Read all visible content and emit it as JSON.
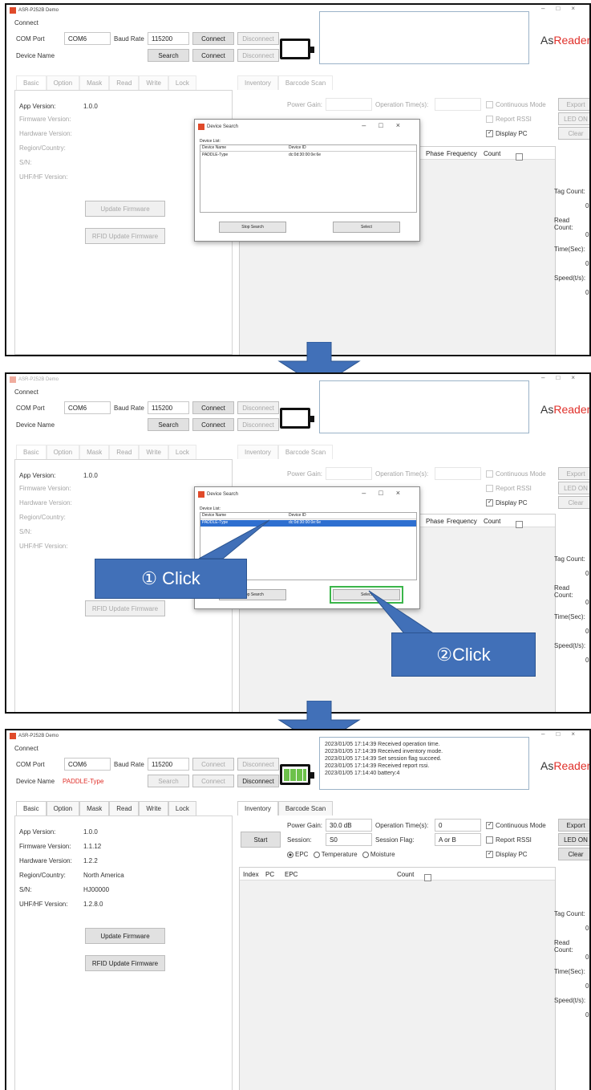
{
  "app": {
    "title": "ASR-P252B Demo",
    "logo_prefix": "As",
    "logo_suffix": "Reader."
  },
  "connect": {
    "group": "Connect",
    "com_port_label": "COM Port",
    "com_port_value": "COM6",
    "baud_rate_label": "Baud Rate",
    "baud_rate_value": "115200",
    "connect_label": "Connect",
    "disconnect_label": "Disconnect",
    "device_name_label": "Device Name",
    "search_label": "Search",
    "device_name_value": "PADDLE-Type"
  },
  "left_tabs": [
    "Basic",
    "Option",
    "Mask",
    "Read",
    "Write",
    "Lock"
  ],
  "right_tabs": [
    "Inventory",
    "Barcode Scan"
  ],
  "basic": {
    "app_version_label": "App Version:",
    "app_version": "1.0.0",
    "firmware_label": "Firmware Version:",
    "firmware": "1.1.12",
    "hardware_label": "Hardware Version:",
    "hardware": "1.2.2",
    "region_label": "Region/Country:",
    "region": "North America",
    "sn_label": "S/N:",
    "sn": "HJ00000",
    "uhf_label": "UHF/HF Version:",
    "uhf": "1.2.8.0",
    "update_firmware": "Update Firmware",
    "rfid_update_firmware": "RFID Update Firmware"
  },
  "inventory": {
    "start": "Start",
    "power_gain_label": "Power Gain:",
    "power_gain": "30.0 dB",
    "operation_time_label": "Operation Time(s):",
    "operation_time": "0",
    "session_label": "Session:",
    "session": "S0",
    "session_flag_label": "Session Flag:",
    "session_flag": "A or B",
    "continuous_mode": "Continuous Mode",
    "report_rssi": "Report RSSI",
    "display_pc": "Display PC",
    "export": "Export",
    "led_on": "LED ON",
    "clear": "Clear",
    "radio_epc": "EPC",
    "radio_temperature": "Temperature",
    "radio_moisture": "Moisture",
    "col_index": "Index",
    "col_pc": "PC",
    "col_epc": "EPC",
    "col_count": "Count",
    "col_phase": "Phase",
    "col_frequency": "Frequency"
  },
  "stats": {
    "tag_count_label": "Tag Count:",
    "tag_count": "0",
    "read_count_label": "Read Count:",
    "read_count": "0",
    "time_label": "Time(Sec):",
    "time": "0",
    "speed_label": "Speed(t/s):",
    "speed": "0"
  },
  "dialog": {
    "title": "Device Search",
    "list_label": "Device List:",
    "col_name": "Device Name",
    "col_id": "Device ID",
    "row_name": "PADDLE-Type",
    "row_id": "dc:0d:30:00:0e:6e",
    "stop_search": "Stop Search",
    "select": "Select"
  },
  "log": [
    "2023/01/05 17:14:39 Received operation time.",
    "2023/01/05 17:14:39 Received inventory mode.",
    "2023/01/05 17:14:39 Set session flag succeed.",
    "2023/01/05 17:14:39 Received report rssi.",
    "2023/01/05 17:14:40 battery:4"
  ],
  "callouts": {
    "step1": "① Click",
    "step2": "②Click"
  },
  "battery_level": 4,
  "colors": {
    "arrow": "#4170b8",
    "highlight": "#3bb54a",
    "battery": "#6cc14a",
    "device_name": "#e0302a"
  }
}
